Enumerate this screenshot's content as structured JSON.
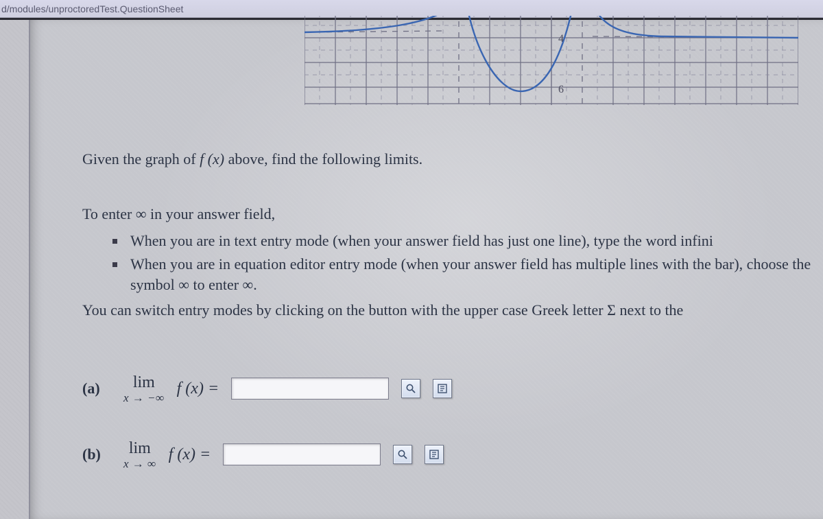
{
  "browser": {
    "url_fragment": "d/modules/unproctoredTest.QuestionSheet"
  },
  "graph": {
    "y_tick_labels": {
      "top": "4",
      "bottom": "6"
    },
    "asymptotes": {
      "left": -6,
      "right": 2
    },
    "x_range": [
      -16,
      16
    ]
  },
  "prompt": {
    "lead_in": "Given the graph of ",
    "function": "f (x)",
    "lead_out": " above, find the following limits."
  },
  "instructions": {
    "heading": "To enter ∞ in your answer field,",
    "bullets": [
      "When you are in text entry mode (when your answer field has just one line), type the word infini",
      "When you are in equation editor entry mode (when your answer field has multiple lines with the bar), choose the symbol ∞ to enter ∞."
    ],
    "switch_pre": "You can switch entry modes by clicking on the button with the upper case Greek letter ",
    "switch_sym": "Σ",
    "switch_post": " next to the"
  },
  "questions": {
    "a": {
      "label": "(a)",
      "lim_label": "lim",
      "lim_under": "x → −∞",
      "expr": "f (x) =",
      "value": ""
    },
    "b": {
      "label": "(b)",
      "lim_label": "lim",
      "lim_under": "x → ∞",
      "expr": "f (x) =",
      "value": ""
    }
  },
  "icons": {
    "preview": "preview-icon",
    "equation_editor": "equation-editor-icon"
  }
}
